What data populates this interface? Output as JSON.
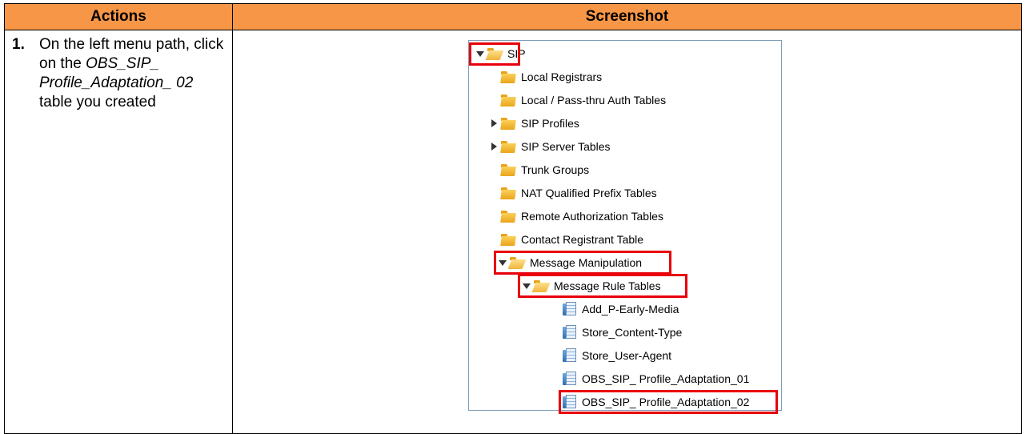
{
  "header": {
    "actions": "Actions",
    "screenshot": "Screenshot"
  },
  "step": {
    "number": "1.",
    "text_before": "On the left menu path, click on the ",
    "text_italic": "OBS_SIP_ Profile_Adaptation_ 02",
    "text_after": " table you created"
  },
  "tree": {
    "sip": "SIP",
    "local_registrars": "Local Registrars",
    "local_passthru": "Local / Pass-thru Auth Tables",
    "sip_profiles": "SIP Profiles",
    "sip_server_tables": "SIP Server Tables",
    "trunk_groups": "Trunk Groups",
    "nat_prefix": "NAT Qualified Prefix Tables",
    "remote_auth": "Remote Authorization Tables",
    "contact_registrant": "Contact Registrant Table",
    "message_manipulation": "Message Manipulation",
    "message_rule_tables": "Message Rule Tables",
    "rules": [
      "Add_P-Early-Media",
      "Store_Content-Type",
      "Store_User-Agent",
      "OBS_SIP_ Profile_Adaptation_01",
      "OBS_SIP_ Profile_Adaptation_02"
    ]
  },
  "colors": {
    "header_bg": "#f79646",
    "highlight": "#e8000b"
  }
}
